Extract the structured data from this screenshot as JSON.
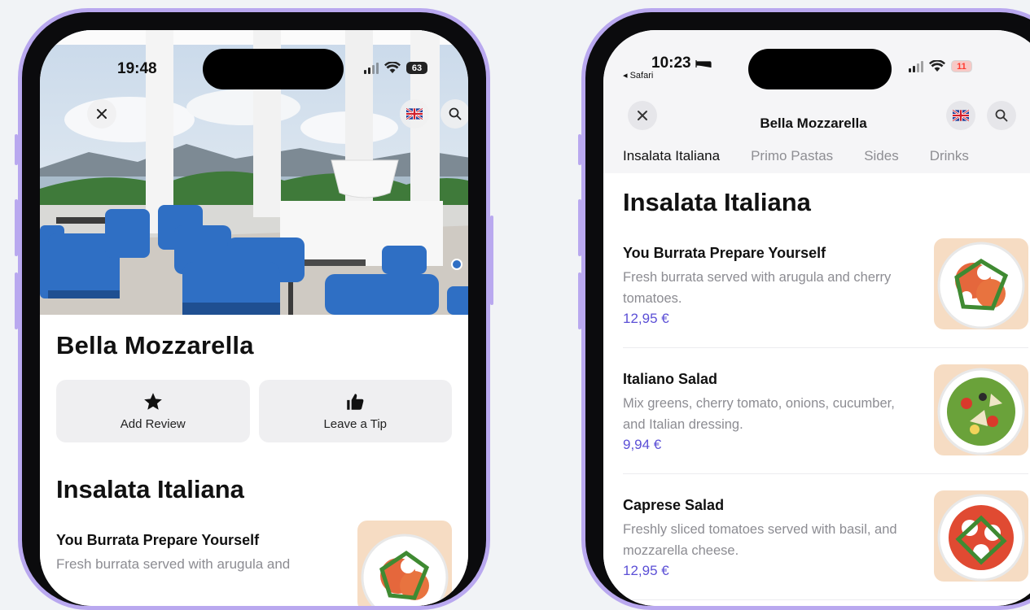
{
  "left_phone": {
    "status": {
      "time": "19:48",
      "battery": "63"
    },
    "restaurant_name": "Bella Mozzarella",
    "actions": [
      {
        "label": "Add Review",
        "icon": "star-icon"
      },
      {
        "label": "Leave a Tip",
        "icon": "thumbs-up-icon"
      }
    ],
    "section_title": "Insalata Italiana",
    "first_item": {
      "name": "You Burrata Prepare Yourself",
      "description": "Fresh burrata served with arugula and"
    }
  },
  "right_phone": {
    "status": {
      "time": "10:23",
      "battery": "11",
      "back_label": "◂ Safari"
    },
    "nav_title": "Bella Mozzarella",
    "tabs": [
      "Insalata Italiana",
      "Primo Pastas",
      "Sides",
      "Drinks"
    ],
    "section_title": "Insalata Italiana",
    "items": [
      {
        "name": "You Burrata Prepare Yourself",
        "description": "Fresh burrata served with arugula and cherry tomatoes.",
        "price": "12,95 €"
      },
      {
        "name": "Italiano Salad",
        "description": "Mix greens, cherry tomato, onions, cucumber, and Italian dressing.",
        "price": "9,94 €"
      },
      {
        "name": "Caprese Salad",
        "description": "Freshly sliced tomatoes served with basil, and mozzarella cheese.",
        "price": "12,95 €"
      }
    ]
  },
  "colors": {
    "frame": "#b9a8ef",
    "price": "#5b4fd6",
    "chair_blue": "#2f6fc4",
    "battery_green": "#3ccf5a",
    "battery_red": "#ff3b30"
  }
}
